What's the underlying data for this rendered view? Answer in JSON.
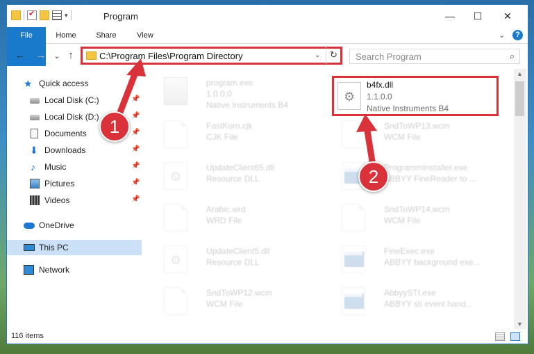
{
  "window": {
    "title": "Program",
    "controls": {
      "minimize": "—",
      "maximize": "☐",
      "close": "✕"
    }
  },
  "ribbon": {
    "tabs": [
      {
        "label": "File"
      },
      {
        "label": "Home"
      },
      {
        "label": "Share"
      },
      {
        "label": "View"
      }
    ],
    "help": "?"
  },
  "nav": {
    "back": "←",
    "forward": "→",
    "recent": "⌄",
    "up": "↑",
    "address": "C:\\Program Files\\Program Directory",
    "refresh": "↻",
    "search_placeholder": "Search Program",
    "search_glyph": "⌕"
  },
  "sidebar": {
    "items": [
      {
        "label": "Quick access",
        "icon": "star-icon",
        "glyph": "★"
      },
      {
        "label": "Local Disk (C:)",
        "icon": "local-disk-icon",
        "pinned": true
      },
      {
        "label": "Local Disk (D:)",
        "icon": "local-disk-icon",
        "pinned": true
      },
      {
        "label": "Documents",
        "icon": "documents-icon",
        "pinned": true
      },
      {
        "label": "Downloads",
        "icon": "downloads-icon",
        "glyph": "⬇",
        "pinned": true
      },
      {
        "label": "Music",
        "icon": "music-icon",
        "glyph": "♪",
        "pinned": true
      },
      {
        "label": "Pictures",
        "icon": "pictures-icon",
        "pinned": true
      },
      {
        "label": "Videos",
        "icon": "videos-icon",
        "pinned": true
      },
      {
        "label": "OneDrive",
        "icon": "onedrive-icon"
      },
      {
        "label": "This PC",
        "icon": "this-pc-icon",
        "selected": true
      },
      {
        "label": "Network",
        "icon": "network-icon"
      }
    ],
    "pin_glyph": "📌"
  },
  "files": [
    {
      "name": "program.exe",
      "line1": "1.0.0.0",
      "line2": "Native Instruments B4",
      "icon": "exe-icon",
      "faded": true
    },
    {
      "name": "b4fx.dll",
      "line1": "1.1.0.0",
      "line2": "Native Instruments B4",
      "icon": "dll-gear-icon",
      "faded": false,
      "highlighted": true
    },
    {
      "name": "FastKorn.cjk",
      "line1": "CJK File",
      "line2": "",
      "icon": "blank-file-icon",
      "faded": true
    },
    {
      "name": "SndToWP13.wcm",
      "line1": "WCM File",
      "line2": "",
      "icon": "blank-file-icon",
      "faded": true
    },
    {
      "name": "UpdateClient65.dll",
      "line1": "Resource DLL",
      "line2": "",
      "icon": "dll-gear-icon",
      "faded": true
    },
    {
      "name": "ProgrammInstaller.exe",
      "line1": "ABBYY FineReader to ...",
      "line2": "",
      "icon": "app-window-icon",
      "faded": true
    },
    {
      "name": "Arabic.wrd",
      "line1": "WRD File",
      "line2": "",
      "icon": "blank-file-icon",
      "faded": true
    },
    {
      "name": "SndToWP14.wcm",
      "line1": "WCM File",
      "line2": "",
      "icon": "blank-file-icon",
      "faded": true
    },
    {
      "name": "UpdateClient5.dll",
      "line1": "Resource DLL",
      "line2": "",
      "icon": "dll-gear-icon",
      "faded": true
    },
    {
      "name": "FineExec.exe",
      "line1": "ABBYY background exe...",
      "line2": "",
      "icon": "app-window-icon",
      "faded": true
    },
    {
      "name": "SndToWP12.wcm",
      "line1": "WCM File",
      "line2": "",
      "icon": "blank-file-icon",
      "faded": true
    },
    {
      "name": "AbbyySTI.exe",
      "line1": "ABBYY sti event hand...",
      "line2": "",
      "icon": "app-window-icon",
      "faded": true
    }
  ],
  "status": {
    "item_count": "116 items"
  },
  "annotations": {
    "badge1": "1",
    "badge2": "2",
    "accent_color": "#d9323a"
  },
  "colors": {
    "accent": "#1979ca",
    "selection": "#cce0f7",
    "highlight_border": "#d9323a"
  }
}
